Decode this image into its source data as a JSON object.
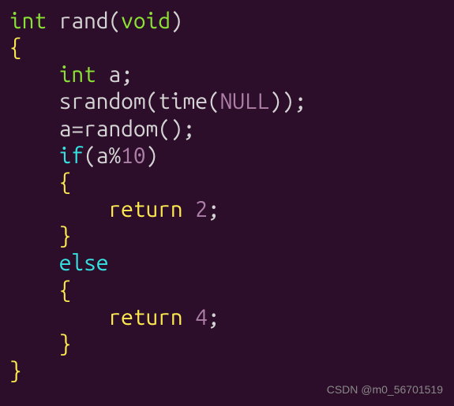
{
  "code": {
    "line1_type": "int",
    "line1_func": "rand",
    "line1_void": "void",
    "line3_type": "int",
    "line3_var": "a",
    "line4_func": "srandom",
    "line4_inner_func": "time",
    "line4_null": "NULL",
    "line5_var": "a",
    "line5_func": "random",
    "line6_if": "if",
    "line6_var": "a",
    "line6_op": "%",
    "line6_num": "10",
    "line8_return": "return",
    "line8_num": "2",
    "line10_else": "else",
    "line12_return": "return",
    "line12_num": "4"
  },
  "watermark": "CSDN @m0_56701519"
}
